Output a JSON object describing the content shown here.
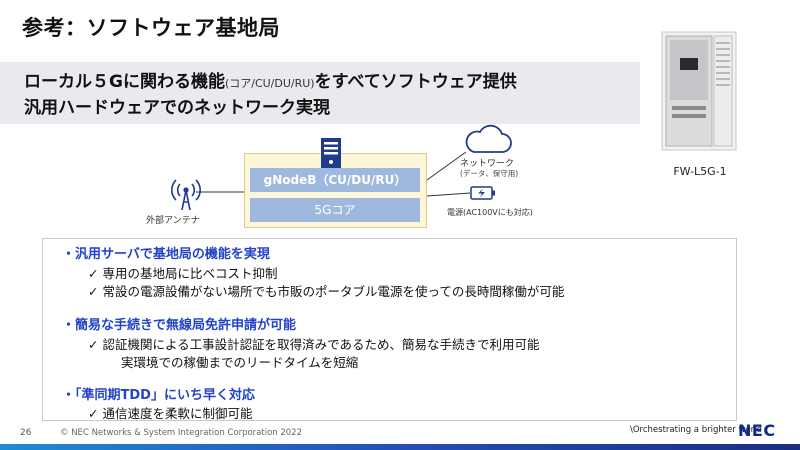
{
  "title": "参考：ソフトウェア基地局",
  "headline": {
    "line1_main": "ローカル５Gに関わる機能",
    "line1_paren": "(コア/CU/DU/RU)",
    "line1_end": "をすべてソフトウェア提供",
    "line2": "汎用ハードウェアでのネットワーク実現"
  },
  "product": {
    "caption": "FW-L5G-1"
  },
  "diagram": {
    "gnodeb_label": "gNodeB（CU/DU/RU）",
    "core_label": "5Gコア",
    "antenna_label": "外部アンテナ",
    "network_label": "ネットワーク",
    "network_sub": "(データ、保守用)",
    "power_label": "電源(AC100Vにも対応)",
    "icons": [
      "server-icon",
      "antenna-icon",
      "cloud-icon",
      "battery-icon"
    ]
  },
  "content": {
    "sections": [
      {
        "heading": "・汎用サーバで基地局の機能を実現",
        "items": [
          "✓  専用の基地局に比ベコスト抑制",
          "✓  常設の電源設備がない場所でも市販のポータブル電源を使っての長時間稼働が可能"
        ]
      },
      {
        "heading": "・簡易な手続きで無線局免許申請が可能",
        "items": [
          "✓    認証機関による工事設計認証を取得済みであるため、簡易な手続きで利用可能",
          "実環境での稼働までのリードタイムを短縮"
        ]
      },
      {
        "heading": "・「準同期TDD」にいち早く対応",
        "items": [
          "✓  通信速度を柔軟に制御可能"
        ]
      }
    ]
  },
  "footer": {
    "page_number": "26",
    "copyright": "© NEC Networks & System Integration Corporation 2022",
    "tagline": "\\Orchestrating a brighter world",
    "logo": "NEC"
  },
  "colors": {
    "accent_blue": "#2343c8",
    "bar_blue": "#9fb8dd",
    "box_yellow": "#fdf6d8",
    "band_gray": "#e8eaed",
    "brand_navy": "#0a2a8a"
  }
}
